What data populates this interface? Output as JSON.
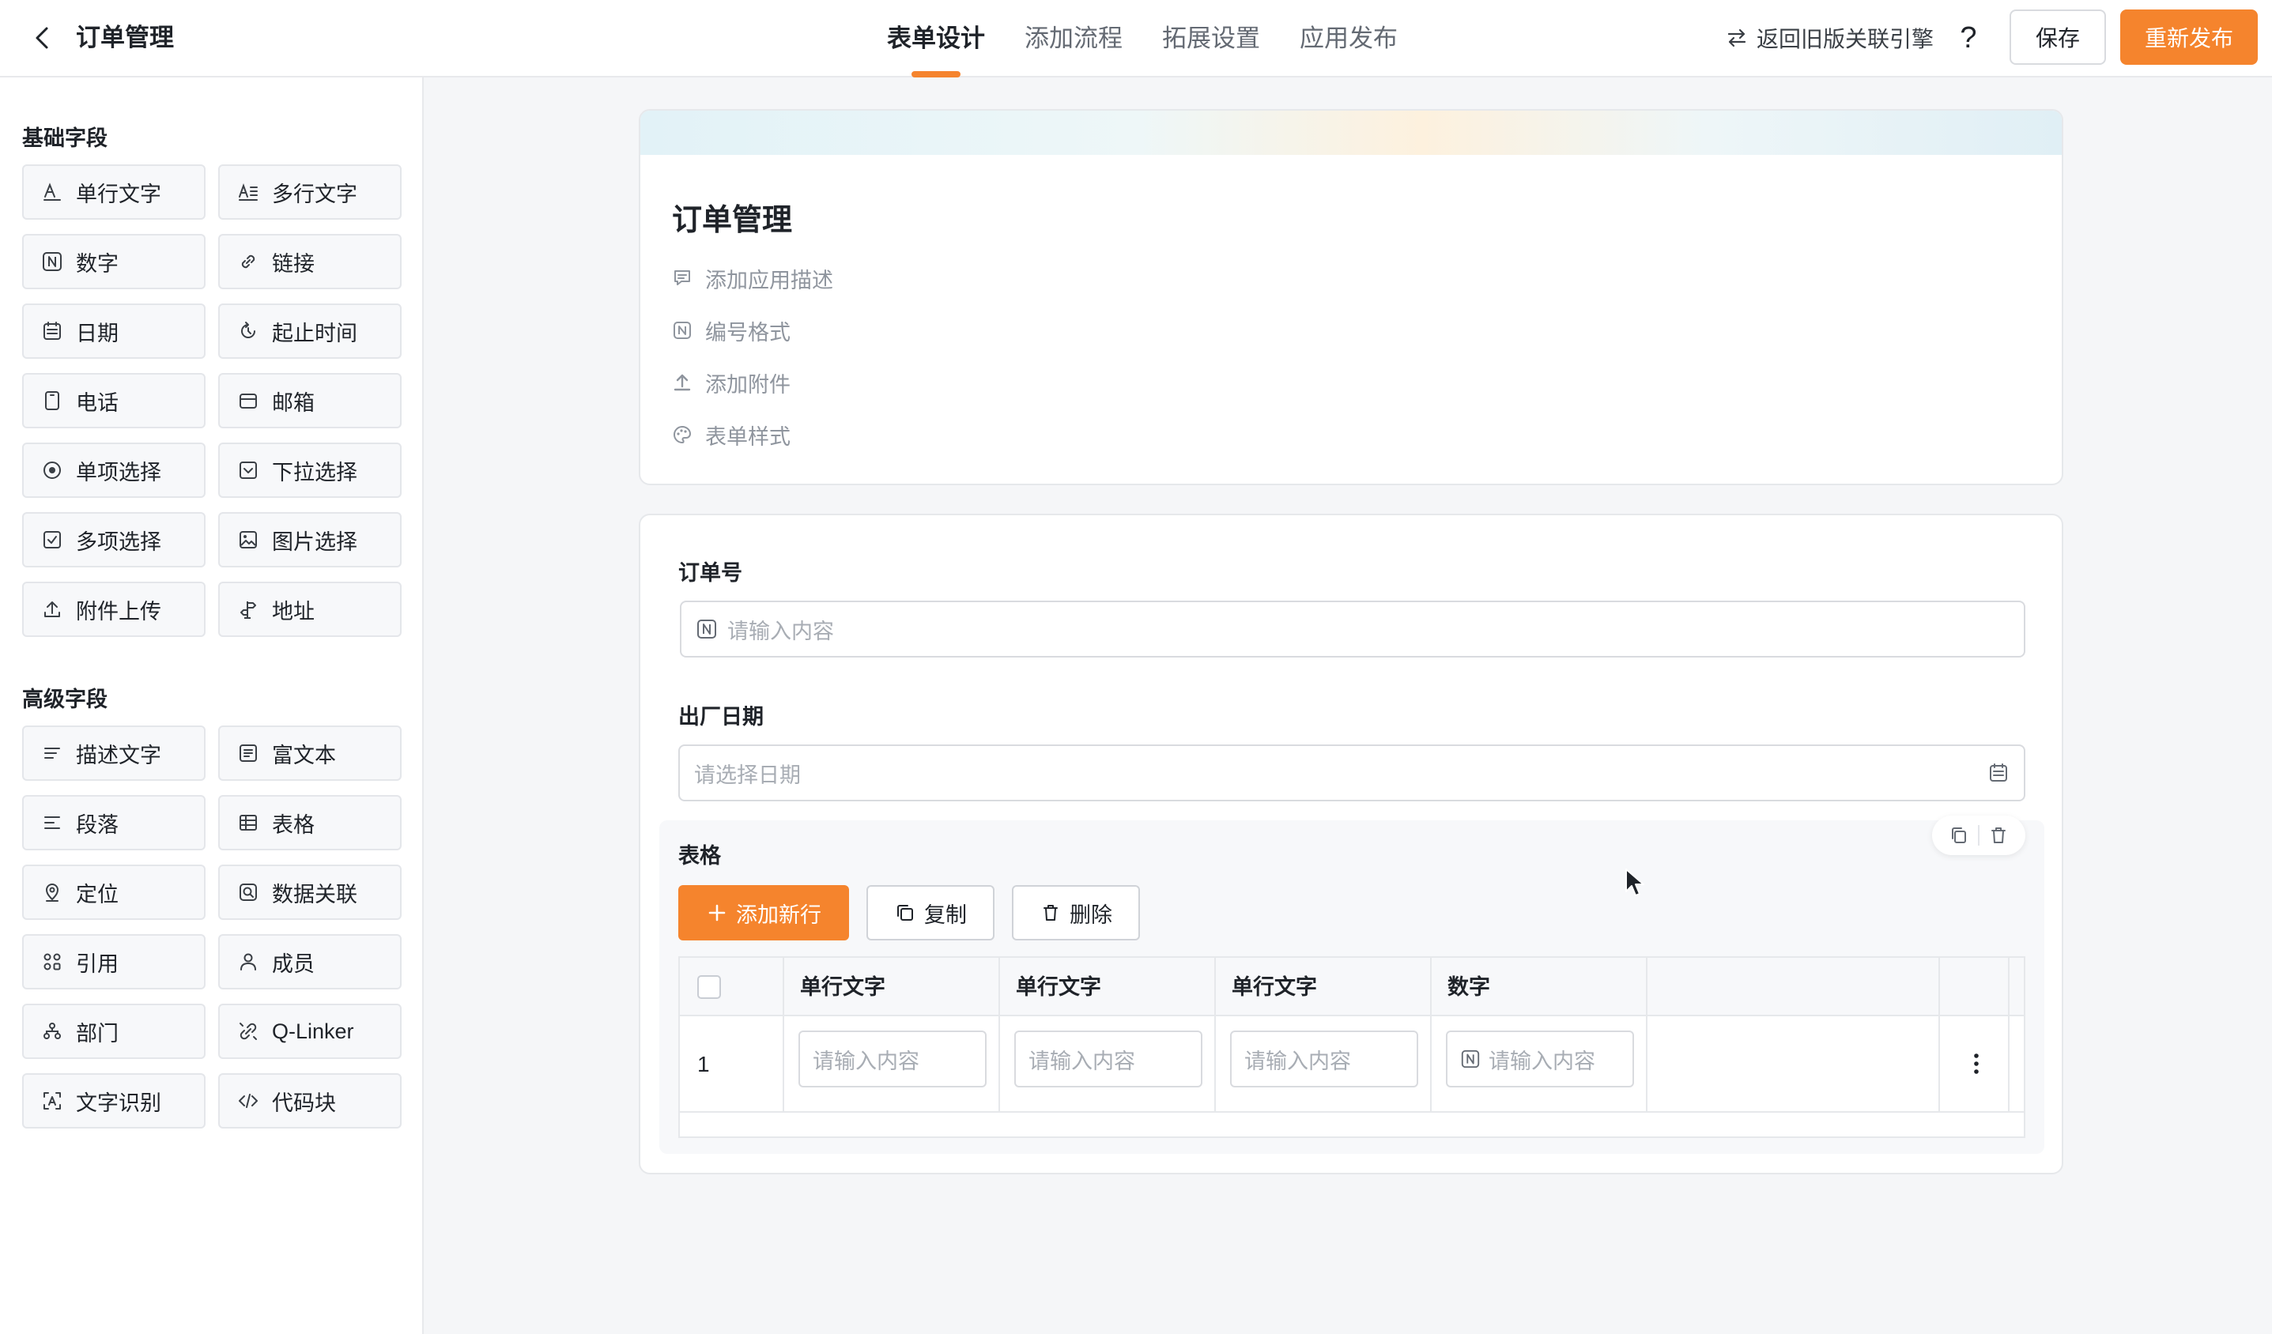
{
  "header": {
    "app_title": "订单管理",
    "tabs": [
      {
        "label": "表单设计",
        "active": true
      },
      {
        "label": "添加流程",
        "active": false
      },
      {
        "label": "拓展设置",
        "active": false
      },
      {
        "label": "应用发布",
        "active": false
      }
    ],
    "legacy_link": "返回旧版关联引擎",
    "help": "?",
    "save_label": "保存",
    "publish_label": "重新发布"
  },
  "sidebar": {
    "basic_title": "基础字段",
    "basic_fields": [
      {
        "label": "单行文字",
        "icon": "text-line-icon"
      },
      {
        "label": "多行文字",
        "icon": "text-multiline-icon"
      },
      {
        "label": "数字",
        "icon": "number-icon"
      },
      {
        "label": "链接",
        "icon": "link-icon"
      },
      {
        "label": "日期",
        "icon": "calendar-icon"
      },
      {
        "label": "起止时间",
        "icon": "time-range-icon"
      },
      {
        "label": "电话",
        "icon": "phone-icon"
      },
      {
        "label": "邮箱",
        "icon": "mail-icon"
      },
      {
        "label": "单项选择",
        "icon": "radio-icon"
      },
      {
        "label": "下拉选择",
        "icon": "dropdown-icon"
      },
      {
        "label": "多项选择",
        "icon": "checkbox-icon"
      },
      {
        "label": "图片选择",
        "icon": "image-icon"
      },
      {
        "label": "附件上传",
        "icon": "upload-icon"
      },
      {
        "label": "地址",
        "icon": "signpost-icon"
      }
    ],
    "advanced_title": "高级字段",
    "advanced_fields": [
      {
        "label": "描述文字",
        "icon": "description-icon"
      },
      {
        "label": "富文本",
        "icon": "rich-text-icon"
      },
      {
        "label": "段落",
        "icon": "paragraph-icon"
      },
      {
        "label": "表格",
        "icon": "table-icon"
      },
      {
        "label": "定位",
        "icon": "location-icon"
      },
      {
        "label": "数据关联",
        "icon": "data-link-icon"
      },
      {
        "label": "引用",
        "icon": "reference-icon"
      },
      {
        "label": "成员",
        "icon": "member-icon"
      },
      {
        "label": "部门",
        "icon": "department-icon"
      },
      {
        "label": "Q-Linker",
        "icon": "qlinker-icon"
      },
      {
        "label": "文字识别",
        "icon": "ocr-icon"
      },
      {
        "label": "代码块",
        "icon": "code-icon"
      }
    ]
  },
  "form_header": {
    "title": "订单管理",
    "items": [
      {
        "label": "添加应用描述",
        "icon": "comment-icon"
      },
      {
        "label": "编号格式",
        "icon": "number-format-icon"
      },
      {
        "label": "添加附件",
        "icon": "attach-upload-icon"
      },
      {
        "label": "表单样式",
        "icon": "palette-icon"
      }
    ]
  },
  "form_body": {
    "order_no": {
      "label": "订单号",
      "placeholder": "请输入内容"
    },
    "ship_date": {
      "label": "出厂日期",
      "placeholder": "请选择日期"
    },
    "table": {
      "label": "表格",
      "add_row": "添加新行",
      "copy": "复制",
      "delete": "删除",
      "columns": [
        "单行文字",
        "单行文字",
        "单行文字",
        "数字"
      ],
      "rows": [
        {
          "index": "1",
          "cells": [
            "请输入内容",
            "请输入内容",
            "请输入内容",
            "请输入内容"
          ]
        }
      ]
    }
  },
  "colors": {
    "accent": "#f5842d",
    "text": "#1f2329",
    "muted": "#8f959e",
    "border": "#d9dbdf"
  }
}
